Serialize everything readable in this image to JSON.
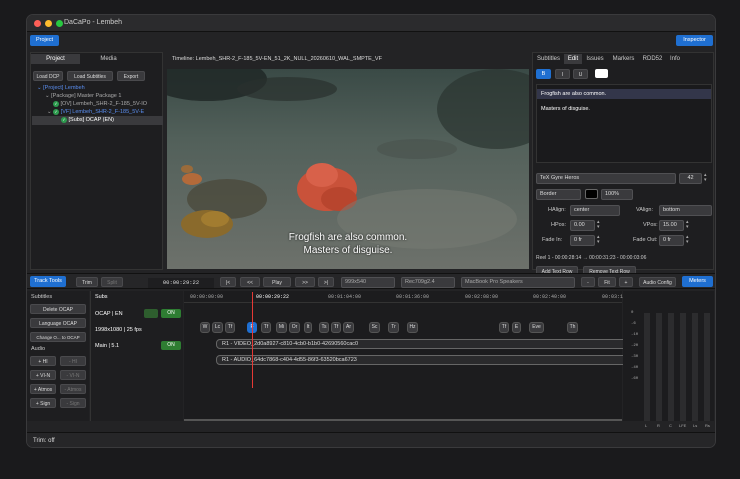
{
  "window": {
    "title": "DaCaPo - Lembeh"
  },
  "toolbar": {
    "project_label": "Project",
    "inspector_label": "Inspector"
  },
  "left_panel": {
    "tabs": [
      "Project",
      "Media"
    ],
    "buttons": [
      "Load DCP",
      "Load Subtitles",
      "Export"
    ],
    "tree": [
      "[Project] Lembeh",
      "[Package] Master Package 1",
      "[OV] Lembeh_SHR-2_F-185_5V-IO",
      "[VF] Lembeh_SHR-2_F-185_5V-E",
      "[Subs] OCAP (EN)"
    ]
  },
  "timeline_title": "Timeline: Lembeh_SHR-2_F-185_5V-EN_51_2K_NULL_20260610_WAL_SMPTE_VF",
  "video": {
    "subtitle_line1": "Frogfish are also common.",
    "subtitle_line2": "Masters of disguise."
  },
  "inspector": {
    "tabs": [
      "Subtitles",
      "Edit",
      "Issues",
      "Markers",
      "RDD52",
      "Info"
    ],
    "format_buttons": [
      "B",
      "I",
      "U"
    ],
    "text_line1": "Frogfish are also common.",
    "text_line2": "Masters of disguise.",
    "font": "TeX Gyre Heros",
    "font_size": "42",
    "effect": "Border",
    "opacity": "100%",
    "halign_label": "HAlign:",
    "halign": "center",
    "valign_label": "VAlign:",
    "valign": "bottom",
    "hpos_label": "HPos:",
    "hpos": "0.00",
    "vpos_label": "VPos:",
    "vpos": "15.00",
    "fadein_label": "Fade In:",
    "fadein": "0 fr",
    "fadeout_label": "Fade Out:",
    "fadeout": "0 fr",
    "reel_info": "Reel 1 - 00:00:28:14 → 00:00:31:23 - 00:00:03:06",
    "add_label": "Add Text Row",
    "remove_label": "Remove Text Row"
  },
  "transport": {
    "track_tools": "Track Tools",
    "trim": "Trim",
    "split": "Split",
    "timecode": "00:00:29:22",
    "start": "|<",
    "back": "<<",
    "play": "Play",
    "fwd": ">>",
    "end": ">|",
    "resolution": "999x540",
    "colorspace": "Rec709g2.4",
    "audio_out": "MacBook Pro Speakers",
    "zoom_out": "-",
    "fit": "Fit",
    "zoom_in": "+",
    "audio_config": "Audio Config",
    "meters": "Meters"
  },
  "track_tools": {
    "subtitles_heading": "Subtitles",
    "delete": "Delete OCAP",
    "language": "Language OCAP",
    "change": "Change O... to OCAP",
    "audio_heading": "Audio",
    "audio_buttons": [
      [
        "+ HI",
        "- HI"
      ],
      [
        "+ VI-N",
        "- VI-N"
      ],
      [
        "+ Atmos",
        "- Atmos"
      ],
      [
        "+ Sign",
        "- Sign"
      ]
    ]
  },
  "tracks": {
    "subs_heading": "Subs",
    "ocap": "OCAP | EN",
    "on1": "ON",
    "video_info": "1998x1080 | 25 fps",
    "main": "Main | 5.1",
    "on2": "ON"
  },
  "ruler": [
    "00:00:00:00",
    "00:00:29:22",
    "00:01:04:00",
    "00:01:36:00",
    "00:02:08:00",
    "00:02:40:00",
    "00:03:1"
  ],
  "tags": [
    "W",
    "Lc",
    "Tf",
    "F",
    "Tf",
    "Mi",
    "Or",
    "It",
    "Ts",
    "Tf",
    "Ar",
    "Sc",
    "Tr",
    "Hz",
    "Tf",
    "E",
    "Eve",
    "Th"
  ],
  "clips": {
    "video": "R1 - VIDEO_2d0a8927-c810-4cb0-b1b0-42690560cac0",
    "audio": "R1 - AUDIO_64dc7868-c404-4d55-86f3-63520bca6723"
  },
  "meters": {
    "scale": [
      "0",
      "-6",
      "-10",
      "-20",
      "-30",
      "-40",
      "-60"
    ],
    "channels": [
      "L",
      "R",
      "C",
      "LFE",
      "Ls",
      "Rs"
    ]
  },
  "status": "Trim: off"
}
